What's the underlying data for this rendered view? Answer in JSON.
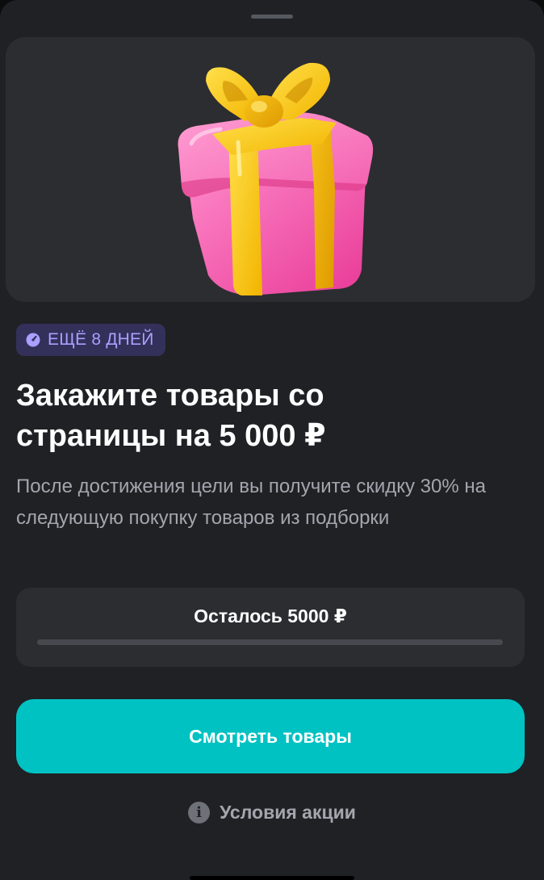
{
  "colors": {
    "background": "#1f2125",
    "card": "#2c2d31",
    "accent": "#00c2c3",
    "badge_bg": "#33305a",
    "badge_text": "#a9a0ff",
    "muted_text": "#a3a6ad"
  },
  "hero": {
    "image_icon": "gift-box-icon"
  },
  "badge": {
    "icon": "clock-icon",
    "text": "ЕЩЁ 8 ДНЕЙ"
  },
  "title": {
    "line1": "Закажите товары со",
    "line2": "страницы на 5 000 ₽"
  },
  "description": "После достижения цели вы получите скидку 30% на следующую покупку товаров из подборки",
  "progress": {
    "label": "Осталось 5000 ₽",
    "fraction": 0
  },
  "cta": {
    "label": "Смотреть товары"
  },
  "terms": {
    "icon": "info-icon",
    "label": "Условия акции"
  }
}
